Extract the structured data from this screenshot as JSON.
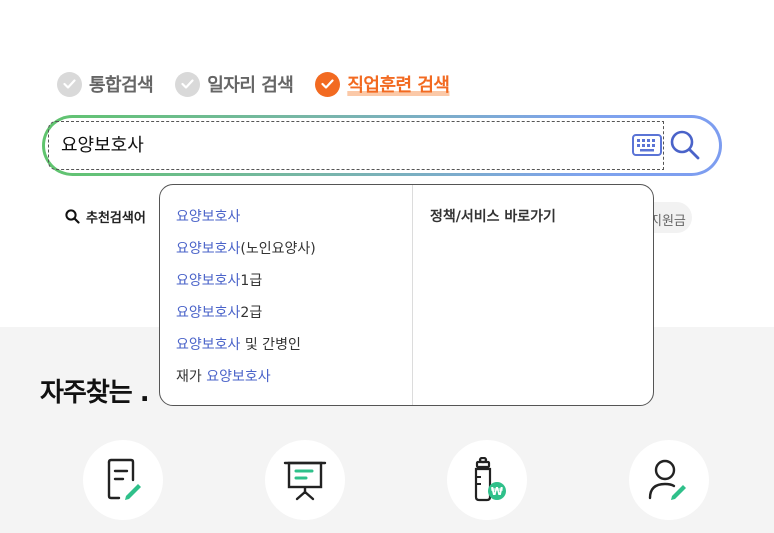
{
  "tabs": [
    {
      "label": "통합검색",
      "active": false
    },
    {
      "label": "일자리 검색",
      "active": false
    },
    {
      "label": "직업훈련 검색",
      "active": true
    }
  ],
  "search": {
    "value": "요양보호사",
    "placeholder": ""
  },
  "recommend": {
    "label": "추천검색어",
    "chip": "지원금",
    "chip_visible": "원금"
  },
  "autocomplete": {
    "items": [
      {
        "highlight": "요양보호사",
        "suffix": "",
        "prefix": ""
      },
      {
        "highlight": "요양보호사",
        "suffix": "(노인요양사)",
        "prefix": ""
      },
      {
        "highlight": "요양보호사",
        "suffix": "1급",
        "prefix": ""
      },
      {
        "highlight": "요양보호사",
        "suffix": "2급",
        "prefix": ""
      },
      {
        "highlight": "요양보호사",
        "suffix": " 및 간병인",
        "prefix": ""
      },
      {
        "highlight": "요양보호사",
        "suffix": "",
        "prefix": "재가 "
      }
    ],
    "shortcut_title": "정책/서비스 바로가기"
  },
  "frequent": {
    "title": "자주찾는 ."
  },
  "icons": [
    "document-edit-icon",
    "presentation-board-icon",
    "baby-bottle-won-icon",
    "user-edit-icon"
  ],
  "colors": {
    "accent": "#f26a21",
    "highlight": "#4a63c9",
    "icon_green": "#2fc08a",
    "search_gradient_start": "#5fc46d",
    "search_gradient_end": "#7d9df0"
  }
}
